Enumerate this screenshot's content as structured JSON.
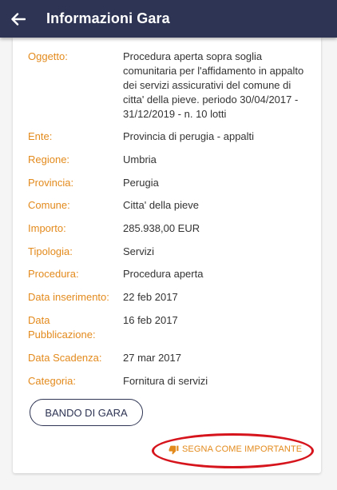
{
  "appbar": {
    "title": "Informazioni Gara",
    "back_icon": "arrow-left-icon",
    "background": "#2e3453"
  },
  "details": {
    "oggetto": {
      "label": "Oggetto:",
      "value": "Procedura aperta sopra soglia comunitaria per l'affidamento in appalto dei servizi assicurativi del comune di citta'  della pieve. periodo 30/04/2017 - 31/12/2019 - n. 10 lotti"
    },
    "ente": {
      "label": "Ente:",
      "value": "Provincia di perugia - appalti"
    },
    "regione": {
      "label": "Regione:",
      "value": "Umbria"
    },
    "provincia": {
      "label": "Provincia:",
      "value": "Perugia"
    },
    "comune": {
      "label": "Comune:",
      "value": "Citta' della pieve"
    },
    "importo": {
      "label": "Importo:",
      "value": "285.938,00 EUR"
    },
    "tipologia": {
      "label": "Tipologia:",
      "value": "Servizi"
    },
    "procedura": {
      "label": "Procedura:",
      "value": "Procedura aperta"
    },
    "data_inserimento": {
      "label": "Data inserimento:",
      "value": "22 feb 2017"
    },
    "data_pubblicazione": {
      "label": "Data Pubblicazione:",
      "value": "16 feb 2017"
    },
    "data_scadenza": {
      "label": "Data Scadenza:",
      "value": "27 mar 2017"
    },
    "categoria": {
      "label": "Categoria:",
      "value": "Fornitura di servizi"
    }
  },
  "actions": {
    "bando_label": "BANDO DI GARA",
    "segna_label": "SEGNA COME IMPORTANTE",
    "segna_icon": "thumbs-down-icon"
  },
  "colors": {
    "label": "#e38a1c",
    "value": "#333333",
    "accent": "#e38a1c",
    "annotation_oval": "#d6141c"
  }
}
